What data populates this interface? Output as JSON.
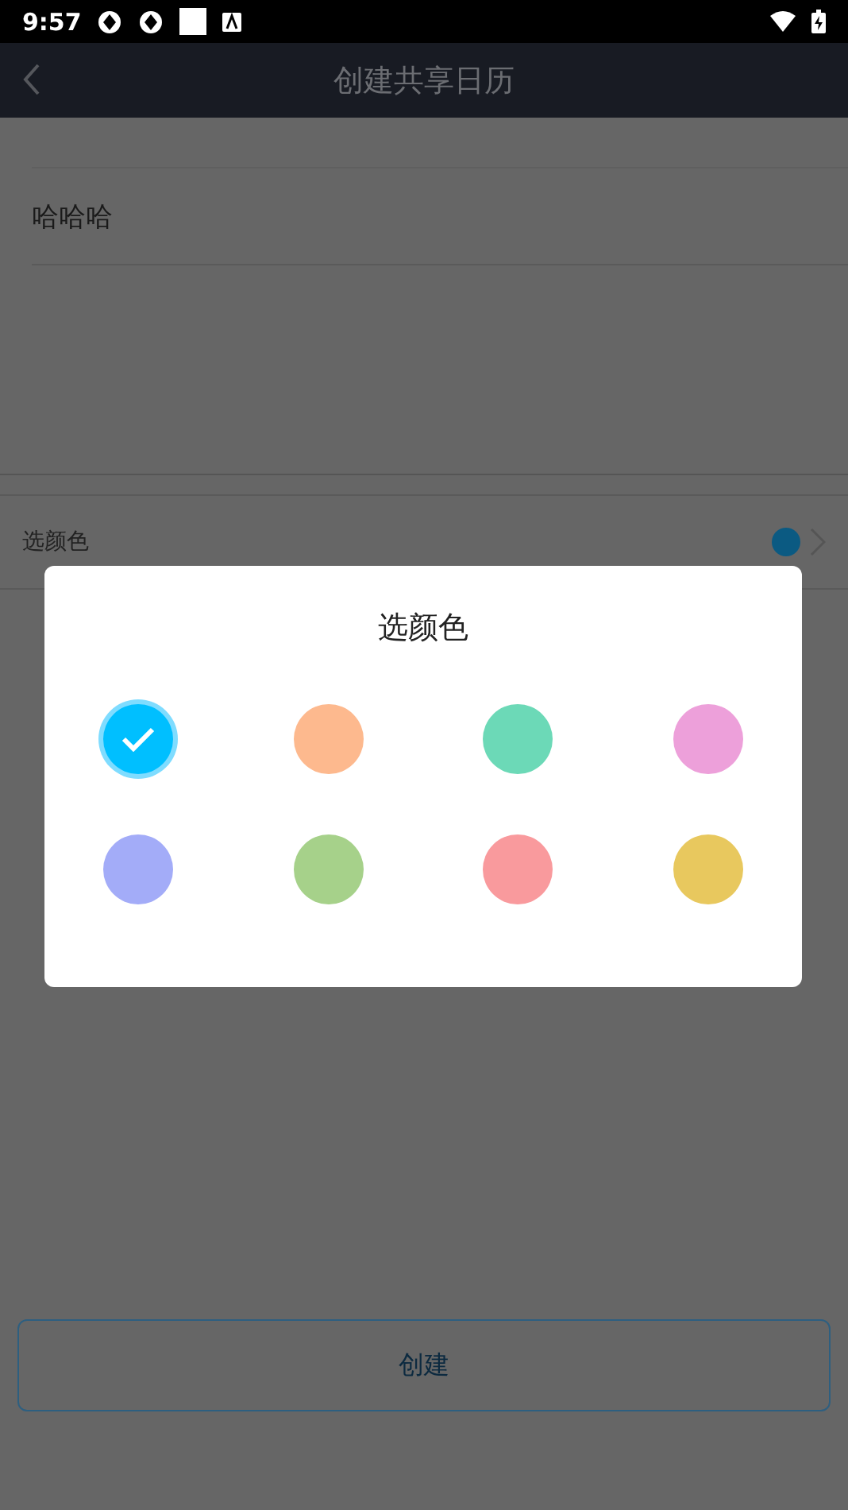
{
  "status_bar": {
    "time": "9:57"
  },
  "header": {
    "title": "创建共享日历"
  },
  "name_field": {
    "value": "哈哈哈"
  },
  "color_row": {
    "label": "选颜色",
    "color": "#0b5a82"
  },
  "dialog": {
    "title": "选颜色",
    "colors": [
      {
        "color": "#00bfff",
        "selected": true
      },
      {
        "color": "#fdb98e",
        "selected": false
      },
      {
        "color": "#6cd9b7",
        "selected": false
      },
      {
        "color": "#eda0da",
        "selected": false
      },
      {
        "color": "#a3acf8",
        "selected": false
      },
      {
        "color": "#a6d18a",
        "selected": false
      },
      {
        "color": "#f99a9d",
        "selected": false
      },
      {
        "color": "#e8c85e",
        "selected": false
      }
    ]
  },
  "create_button": {
    "label": "创建"
  }
}
